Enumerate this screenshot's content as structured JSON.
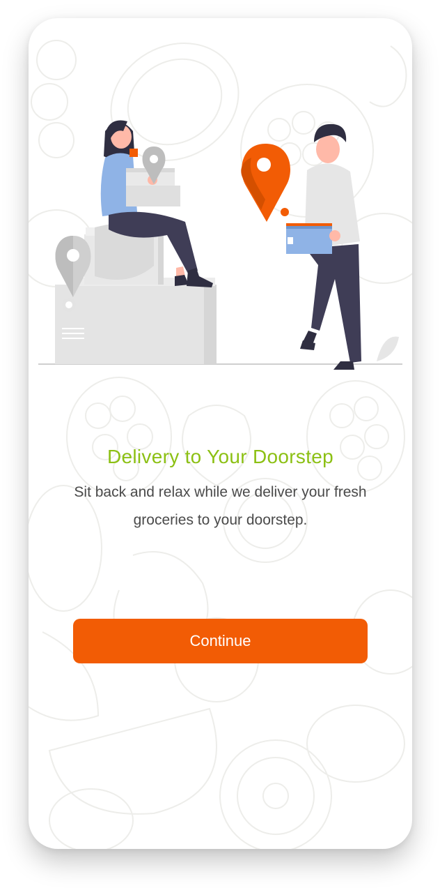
{
  "onboarding": {
    "title": "Delivery to Your Doorstep",
    "description": "Sit back and relax while we deliver your fresh groceries to your doorstep.",
    "continue_label": "Continue"
  },
  "colors": {
    "title": "#8cc014",
    "button": "#f25c05",
    "pin_accent": "#f25c05",
    "text": "#4a4a4a"
  },
  "illustration": {
    "icons": [
      "delivery-woman",
      "delivery-man",
      "location-pin-icon",
      "box-icon"
    ]
  }
}
